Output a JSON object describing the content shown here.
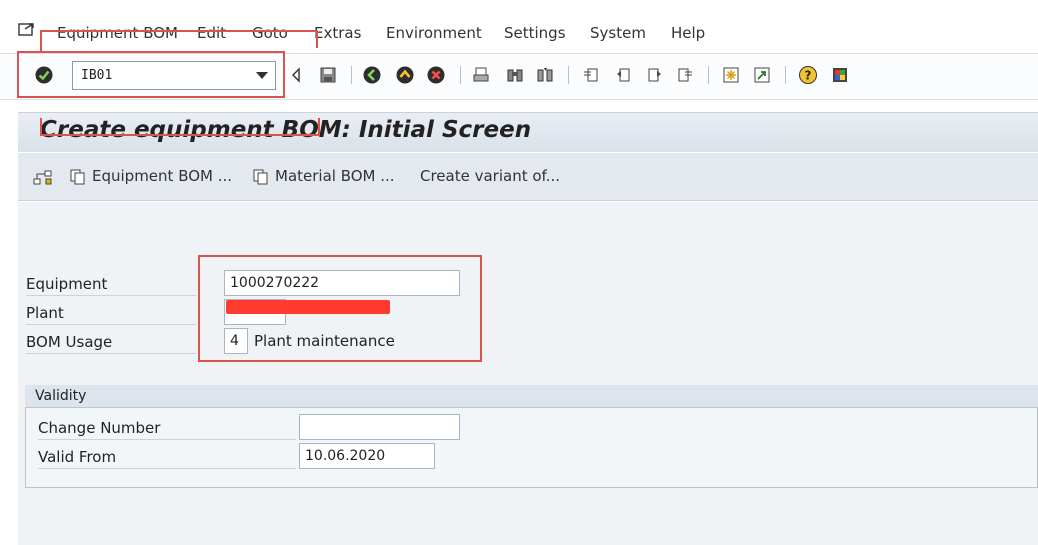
{
  "menu": {
    "items": [
      "Equipment BOM",
      "Edit",
      "Goto",
      "Extras",
      "Environment",
      "Settings",
      "System",
      "Help"
    ]
  },
  "toolbar": {
    "command_value": "IB01"
  },
  "page": {
    "title": "Create equipment BOM: Initial Screen"
  },
  "app_toolbar": {
    "equipment_bom": "Equipment BOM ...",
    "material_bom": "Material BOM ...",
    "create_variant": "Create variant of..."
  },
  "form": {
    "equipment_label": "Equipment",
    "equipment_value": "1000270222",
    "plant_label": "Plant",
    "bom_usage_label": "BOM Usage",
    "bom_usage_value": "4",
    "bom_usage_text": "Plant maintenance"
  },
  "validity": {
    "title": "Validity",
    "change_number_label": "Change Number",
    "change_number_value": "",
    "valid_from_label": "Valid From",
    "valid_from_value": "10.06.2020"
  },
  "colors": {
    "annotation_red": "#d9534f",
    "title_band": "#e0e7ee"
  }
}
